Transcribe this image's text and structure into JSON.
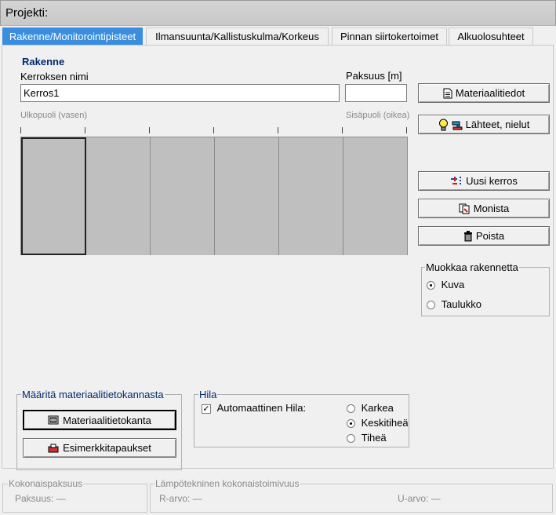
{
  "window": {
    "title": "Projekti:"
  },
  "tabs": [
    {
      "label": "Rakenne/Monitorointipisteet",
      "active": true
    },
    {
      "label": "Ilmansuunta/Kallistuskulma/Korkeus",
      "active": false
    },
    {
      "label": "Pinnan siirtokertoimet",
      "active": false
    },
    {
      "label": "Alkuolosuhteet",
      "active": false
    }
  ],
  "structure": {
    "heading": "Rakenne",
    "layer_name_label": "Kerroksen nimi",
    "layer_name_value": "Kerros1",
    "thickness_label": "Paksuus [m]",
    "thickness_value": "",
    "outside_label": "Ulkopuoli (vasen)",
    "inside_label": "Sisäpuoli (oikea)",
    "layer_count": 6,
    "selected_layer_index": 0
  },
  "actions": {
    "material_info": "Materiaalitiedot",
    "sources_sinks": "Lähteet, nielut",
    "new_layer": "Uusi kerros",
    "duplicate": "Monista",
    "delete": "Poista"
  },
  "edit_mode": {
    "title": "Muokkaa rakennetta",
    "options": [
      "Kuva",
      "Taulukko"
    ],
    "selected": "Kuva"
  },
  "material_db": {
    "title": "Määritä materiaalitietokannasta",
    "database_button": "Materiaalitietokanta",
    "examples_button": "Esimerkkitapaukset"
  },
  "grid": {
    "title": "Hila",
    "auto_label": "Automaattinen Hila:",
    "auto_checked": true,
    "check_mark": "✓",
    "options": [
      "Karkea",
      "Keskitiheä",
      "Tiheä"
    ],
    "selected": "Keskitiheä"
  },
  "status": {
    "total_thickness_title": "Kokonaispaksuus",
    "thickness_text": "Paksuus: —",
    "thermal_title": "Lämpötekninen kokonaistoimivuus",
    "r_value_text": "R-arvo: —",
    "u_value_text": "U-arvo: —"
  },
  "colors": {
    "active_tab": "#3b8de0",
    "heading": "#002a6e",
    "layer_fill": "#bfbfbf"
  }
}
